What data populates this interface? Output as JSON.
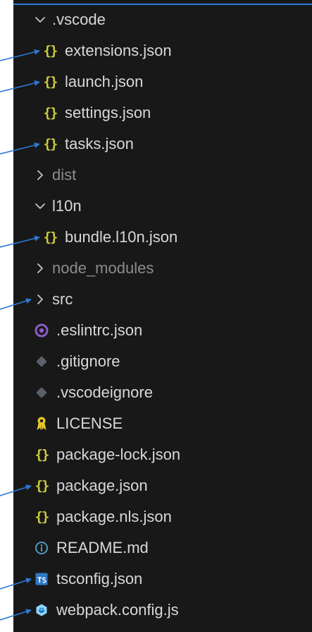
{
  "explorer": {
    "items": [
      {
        "key": "vscode",
        "label": ".vscode",
        "kind": "folder",
        "expanded": true,
        "depth": 0,
        "dim": false
      },
      {
        "key": "extensions",
        "label": "extensions.json",
        "kind": "json-file",
        "depth": 1,
        "dim": false
      },
      {
        "key": "launch",
        "label": "launch.json",
        "kind": "json-file",
        "depth": 1,
        "dim": false
      },
      {
        "key": "settings",
        "label": "settings.json",
        "kind": "json-file",
        "depth": 1,
        "dim": false
      },
      {
        "key": "tasks",
        "label": "tasks.json",
        "kind": "json-file",
        "depth": 1,
        "dim": false
      },
      {
        "key": "dist",
        "label": "dist",
        "kind": "folder",
        "expanded": false,
        "depth": 0,
        "dim": true
      },
      {
        "key": "l10n",
        "label": "l10n",
        "kind": "folder",
        "expanded": true,
        "depth": 0,
        "dim": false
      },
      {
        "key": "bundle-l10n",
        "label": "bundle.l10n.json",
        "kind": "json-file",
        "depth": 1,
        "dim": false
      },
      {
        "key": "node-modules",
        "label": "node_modules",
        "kind": "folder",
        "expanded": false,
        "depth": 0,
        "dim": true
      },
      {
        "key": "src",
        "label": "src",
        "kind": "folder",
        "expanded": false,
        "depth": 0,
        "dim": false
      },
      {
        "key": "eslintrc",
        "label": ".eslintrc.json",
        "kind": "eslint-file",
        "depth": 0,
        "dim": false
      },
      {
        "key": "gitignore",
        "label": ".gitignore",
        "kind": "git-file",
        "depth": 0,
        "dim": false
      },
      {
        "key": "vscodeignore",
        "label": ".vscodeignore",
        "kind": "git-file",
        "depth": 0,
        "dim": false
      },
      {
        "key": "license",
        "label": "LICENSE",
        "kind": "license-file",
        "depth": 0,
        "dim": false
      },
      {
        "key": "package-lock",
        "label": "package-lock.json",
        "kind": "json-file",
        "depth": 0,
        "dim": false
      },
      {
        "key": "package",
        "label": "package.json",
        "kind": "json-file",
        "depth": 0,
        "dim": false
      },
      {
        "key": "package-nls",
        "label": "package.nls.json",
        "kind": "json-file",
        "depth": 0,
        "dim": false
      },
      {
        "key": "readme",
        "label": "README.md",
        "kind": "info-file",
        "depth": 0,
        "dim": false
      },
      {
        "key": "tsconfig",
        "label": "tsconfig.json",
        "kind": "ts-file",
        "depth": 0,
        "dim": false
      },
      {
        "key": "webpack",
        "label": "webpack.config.js",
        "kind": "webpack-file",
        "depth": 0,
        "dim": false
      }
    ],
    "marked_items": [
      "extensions",
      "launch",
      "tasks",
      "bundle-l10n",
      "src",
      "package",
      "tsconfig",
      "webpack"
    ]
  },
  "colors": {
    "panel_background": "#181818",
    "text": "#d8d8d8",
    "dim_text": "#8c8c8c",
    "json_icon": "#cbcb41",
    "annotation_arrow": "#2b79d8",
    "eslint_icon": "#8b5cc6",
    "git_icon": "#59606a",
    "license_icon": "#e8c52a",
    "info_icon": "#519aba",
    "ts_icon": "#3178c6",
    "webpack_icon": "#8ed6fb"
  }
}
